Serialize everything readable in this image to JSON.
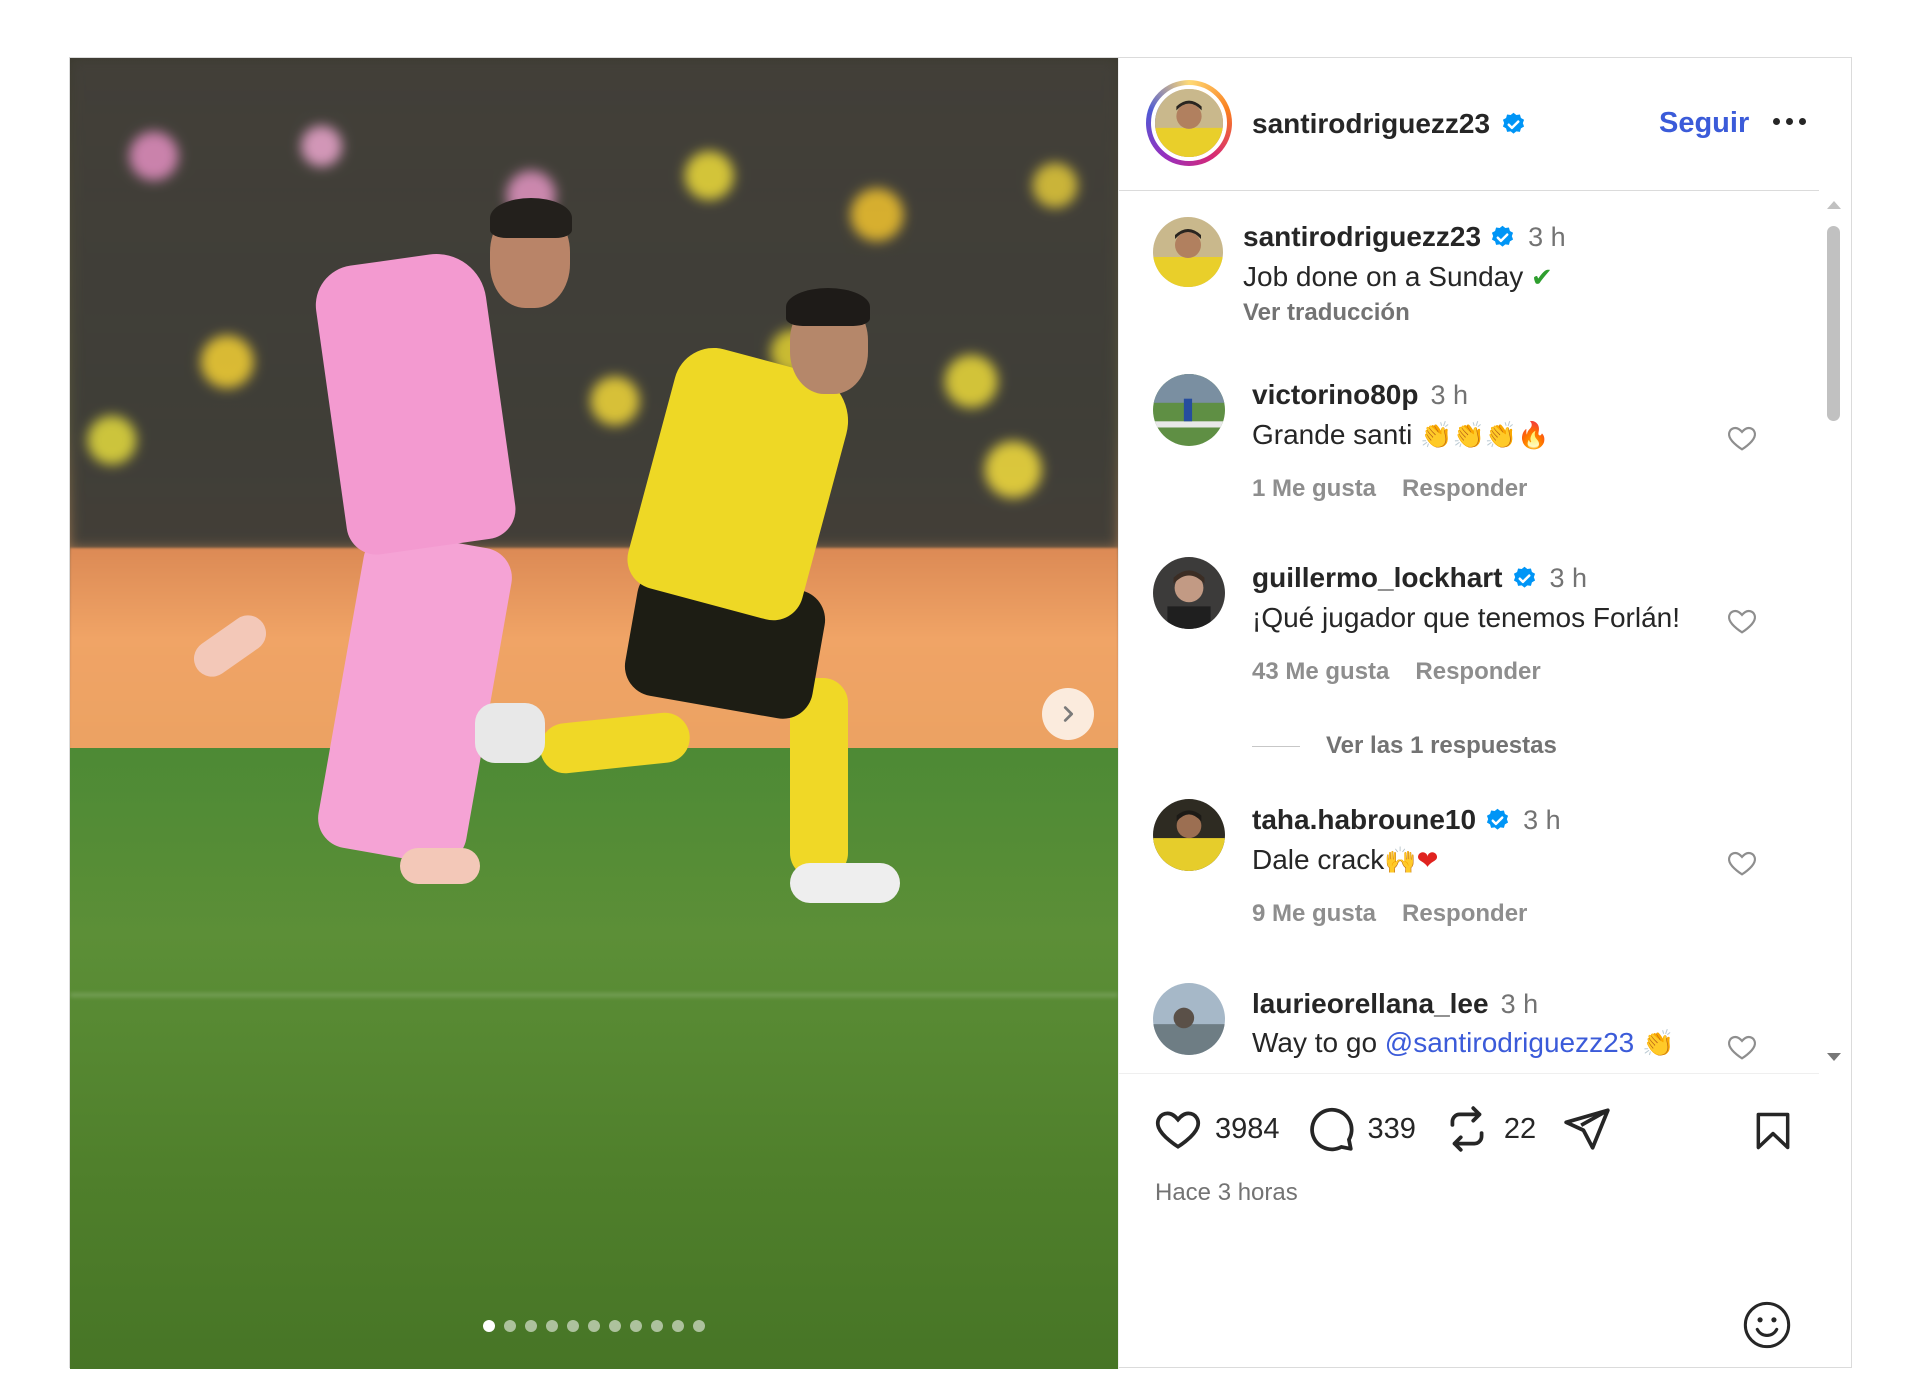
{
  "post": {
    "author": "santirodriguezz23",
    "follow_label": "Seguir",
    "carousel_count": 11,
    "carousel_active_index": 0
  },
  "caption": {
    "username": "santirodriguezz23",
    "time": "3 h",
    "text": "Job done on a Sunday",
    "text_emoji": "✔",
    "translate_label": "Ver traducción"
  },
  "comments": [
    {
      "username": "victorino80p",
      "verified": false,
      "time": "3 h",
      "text": "Grande santi",
      "emoji": "👏👏👏🔥",
      "likes": "1 Me gusta",
      "reply_label": "Responder"
    },
    {
      "username": "guillermo_lockhart",
      "verified": true,
      "time": "3 h",
      "text": "¡Qué jugador que tenemos Forlán!",
      "likes": "43 Me gusta",
      "reply_label": "Responder",
      "view_replies": "Ver las 1 respuestas"
    },
    {
      "username": "taha.habroune10",
      "verified": true,
      "time": "3 h",
      "text": "Dale crack",
      "emoji": "🙌❤",
      "likes": "9 Me gusta",
      "reply_label": "Responder"
    },
    {
      "username": "laurieorellana_lee",
      "verified": false,
      "time": "3 h",
      "text": "Way to go",
      "mention": "@santirodriguezz23",
      "emoji": "👏"
    }
  ],
  "actions": {
    "likes": "3984",
    "comments": "339",
    "reposts": "22"
  },
  "posted_ago": "Hace 3 horas",
  "colors": {
    "link_blue": "#3b5bd9",
    "verified_blue": "#0095f6",
    "muted": "#737373"
  }
}
